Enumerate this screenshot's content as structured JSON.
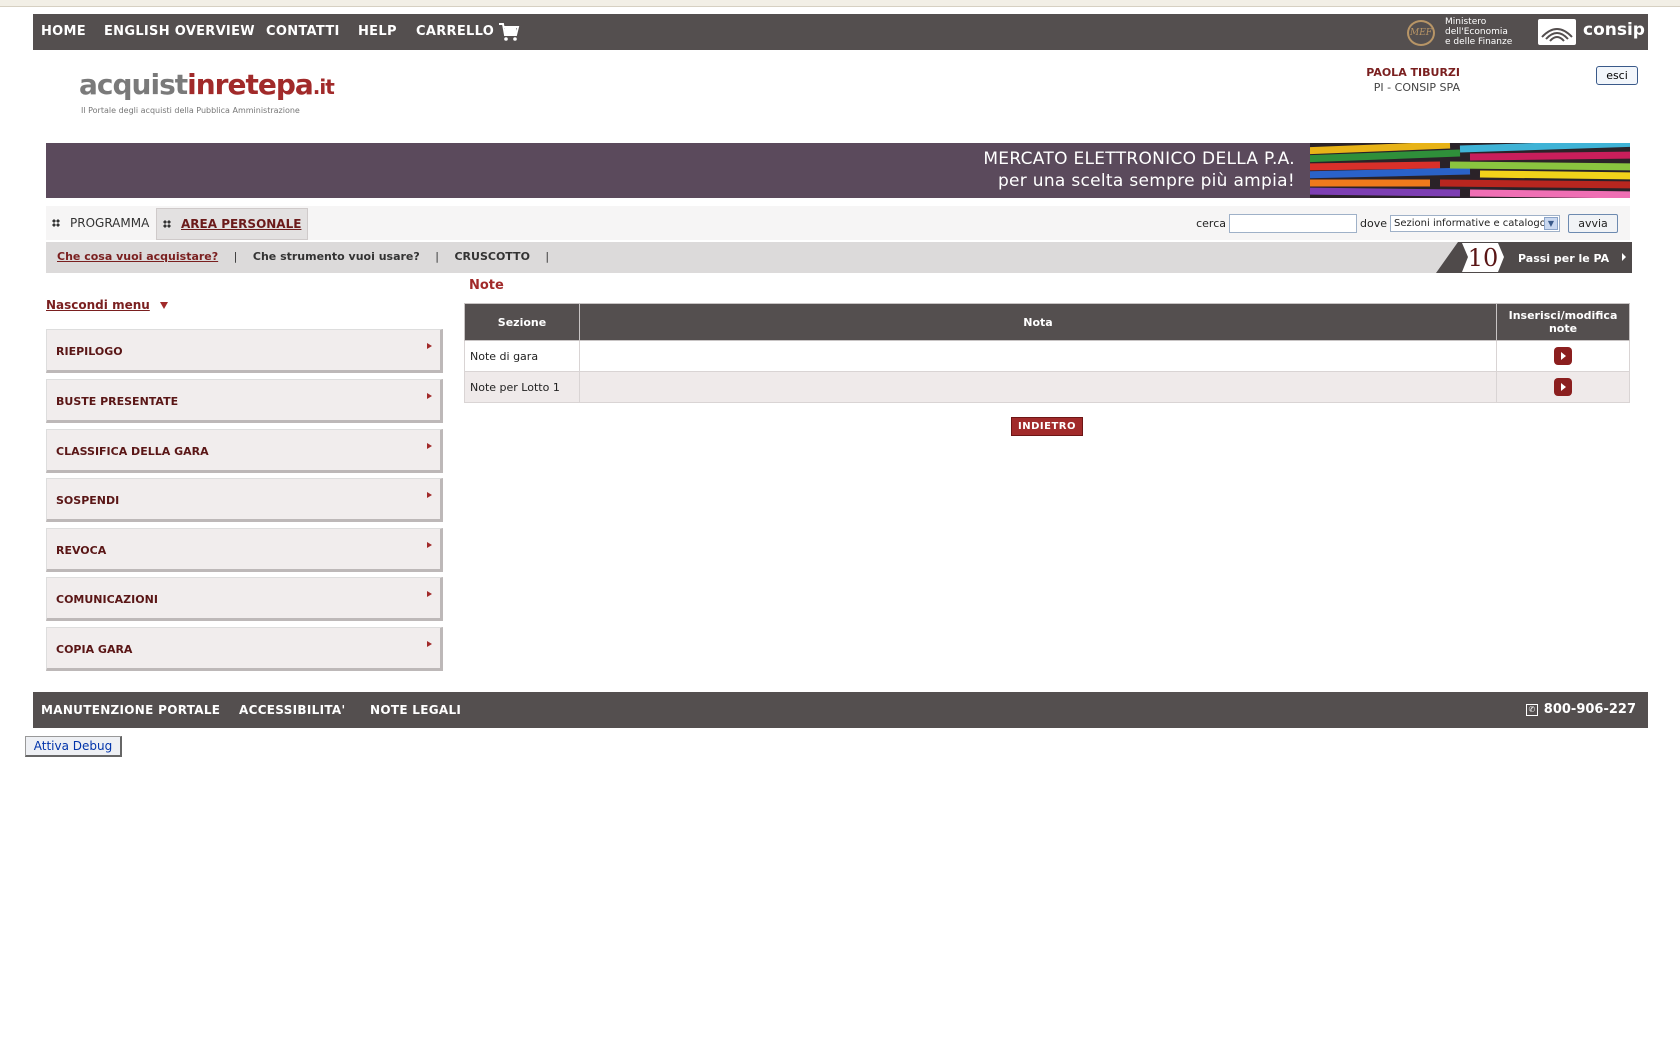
{
  "topnav": {
    "items": [
      "HOME",
      "ENGLISH OVERVIEW",
      "CONTATTI",
      "HELP",
      "CARRELLO"
    ],
    "mef_logo_text": "MEF",
    "mef_text": "Ministero\ndell'Economia\ne delle Finanze",
    "consip": "consip"
  },
  "brand": {
    "part1": "acquist",
    "part2": "inrete",
    "part3": "pa",
    "part4": ".it",
    "subtitle": "Il Portale degli acquisti della Pubblica Amministrazione"
  },
  "user": {
    "name": "PAOLA TIBURZI",
    "org": "PI - CONSIP SPA",
    "logout_label": "esci"
  },
  "banner": {
    "line1": "MERCATO ELETTRONICO DELLA P.A.",
    "line2": "per una scelta sempre più ampia!"
  },
  "tabs": [
    {
      "label": "PROGRAMMA",
      "active": false
    },
    {
      "label": "AREA PERSONALE",
      "active": true
    }
  ],
  "search": {
    "cerca_label": "cerca",
    "dove_label": "dove",
    "input_value": "",
    "select_value": "Sezioni informative e catalogo",
    "button_label": "avvia"
  },
  "subnav": {
    "links": [
      "Che cosa vuoi acquistare?",
      "Che strumento vuoi usare?",
      "CRUSCOTTO"
    ],
    "separator": "|",
    "passi_number": "10",
    "passi_label": "Passi per le PA"
  },
  "sidebar": {
    "toggle_label": "Nascondi menu",
    "items": [
      "RIEPILOGO",
      "BUSTE PRESENTATE",
      "CLASSIFICA DELLA GARA",
      "SOSPENDI",
      "REVOCA",
      "COMUNICAZIONI",
      "COPIA GARA"
    ]
  },
  "main": {
    "title": "Note",
    "columns": [
      "Sezione",
      "Nota",
      "Inserisci/modifica note"
    ],
    "rows": [
      {
        "sezione": "Note di gara",
        "nota": ""
      },
      {
        "sezione": "Note per Lotto 1",
        "nota": ""
      }
    ],
    "back_button": "INDIETRO"
  },
  "footer": {
    "items": [
      "MANUTENZIONE PORTALE",
      "ACCESSIBILITA'",
      "NOTE LEGALI"
    ],
    "phone": "800-906-227"
  },
  "debug_button": "Attiva Debug",
  "colors": {
    "nav_bg": "#544f4f",
    "accent": "#a12a2a",
    "banner_bg": "#5b4a5c"
  }
}
